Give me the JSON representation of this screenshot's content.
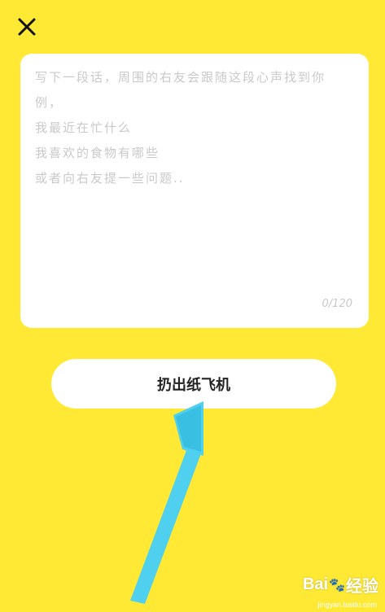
{
  "header": {
    "close_icon": "close-icon"
  },
  "editor": {
    "placeholder_lines": [
      "写下一段话，周围的右友会跟随这段心声找到你",
      "例，",
      "我最近在忙什么",
      "我喜欢的食物有哪些",
      "或者向右友提一些问题.."
    ],
    "counter": "0/120"
  },
  "action": {
    "throw_label": "扔出纸飞机"
  },
  "annotation": {
    "arrow_color": "#4fd0ef"
  },
  "watermark": {
    "brand_prefix": "Bai",
    "brand_suffix": "经验",
    "site": "jingyan.baidu.com"
  },
  "colors": {
    "background": "#ffe935",
    "card": "#ffffff",
    "placeholder": "#c9c9c9"
  }
}
